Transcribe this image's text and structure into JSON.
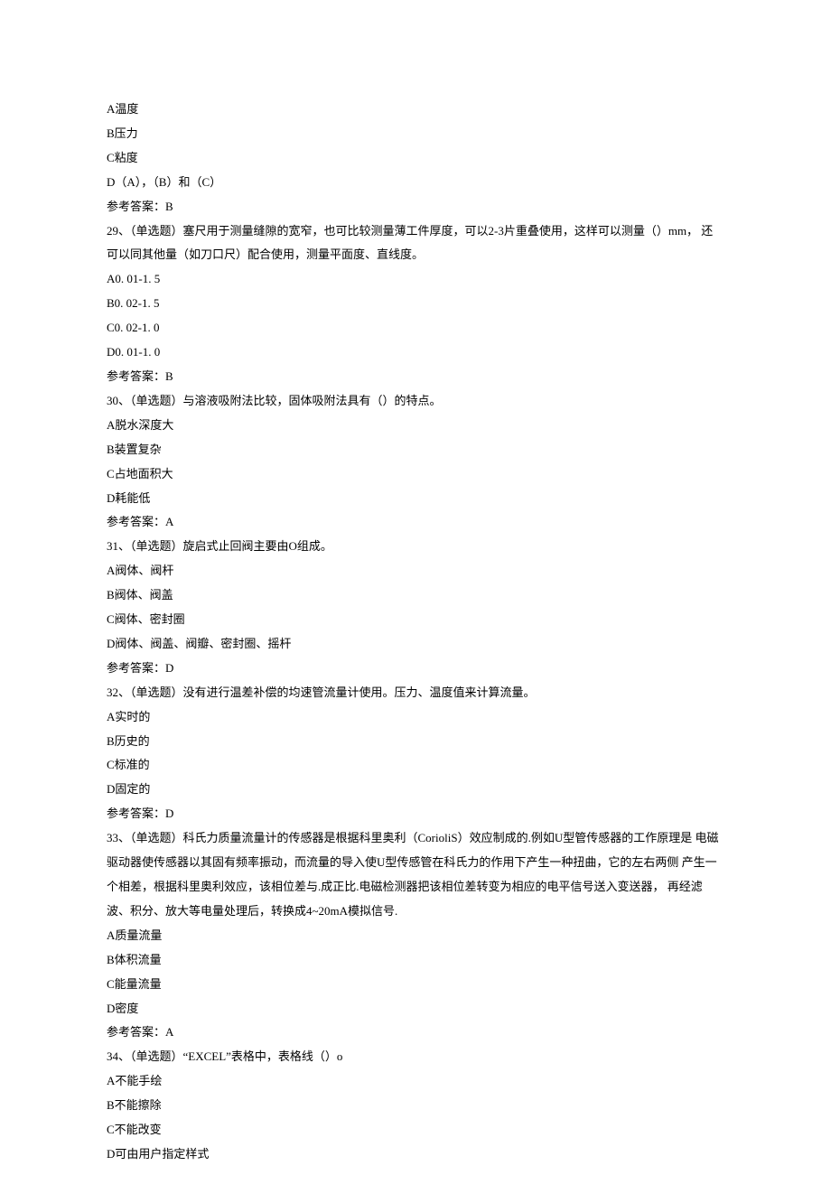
{
  "lines": [
    "A温度",
    "B压力",
    "C粘度",
    "D（A），（B）和（C）",
    "参考答案：B",
    "29、（单选题）塞尺用于测量缝隙的宽窄，也可比较测量薄工件厚度，可以2-3片重叠使用，这样可以测量（）mm， 还可以同其他量（如刀口尺）配合使用，测量平面度、直线度。",
    "A0. 01-1. 5",
    "B0. 02-1. 5",
    "C0. 02-1. 0",
    "D0. 01-1. 0",
    "参考答案：B",
    "30、（单选题）与溶液吸附法比较，固体吸附法具有（）的特点。",
    "A脱水深度大",
    "B装置复杂",
    "C占地面积大",
    "D耗能低",
    "参考答案：A",
    "31、（单选题）旋启式止回阀主要由O组成。",
    "A阀体、阀杆",
    "B阀体、阀盖",
    "C阀体、密封圈",
    "D阀体、阀盖、阀瓣、密封圈、摇杆",
    "参考答案：D",
    "32、（单选题）没有进行温差补偿的均速管流量计使用。压力、温度值来计算流量。",
    "A实时的",
    "B历史的",
    "C标准的",
    "D固定的",
    "参考答案：D",
    "33、（单选题）科氏力质量流量计的传感器是根据科里奥利（CorioliS）效应制成的.例如U型管传感器的工作原理是 电磁驱动器使传感器以其固有频率振动，而流量的导入使U型传感管在科氏力的作用下产生一种扭曲，它的左右两侧 产生一个相差，根据科里奥利效应，该相位差与.成正比.电磁检测器把该相位差转变为相应的电平信号送入变送器， 再经滤波、积分、放大等电量处理后，转换成4~20mA模拟信号.",
    "A质量流量",
    "B体积流量",
    "C能量流量",
    "D密度",
    "参考答案：A",
    "34、（单选题）“EXCEL”表格中，表格线（）o",
    "A不能手绘",
    "B不能擦除",
    "C不能改变",
    "D可由用户指定样式"
  ]
}
